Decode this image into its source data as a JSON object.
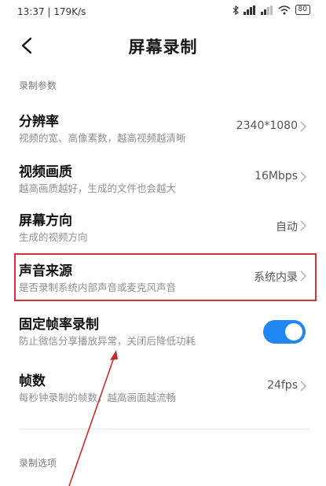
{
  "status_bar": {
    "time_speed": "13:37 | 179K/s",
    "battery": "80"
  },
  "header": {
    "title": "屏幕录制"
  },
  "sections": {
    "recording_params": "录制参数",
    "recording_options": "录制选项"
  },
  "settings": [
    {
      "title": "分辨率",
      "desc": "视频的宽、高像素数，越高视频越清晰",
      "value": "2340*1080"
    },
    {
      "title": "视频画质",
      "desc": "越高画质越好，生成的文件也会越大",
      "value": "16Mbps"
    },
    {
      "title": "屏幕方向",
      "desc": "生成的视频方向",
      "value": "自动"
    },
    {
      "title": "声音来源",
      "desc": "是否录制系统内部声音或麦克风声音",
      "value": "系统内录"
    },
    {
      "title": "固定帧率录制",
      "desc": "防止微信分享播放异常，关闭后降低功耗",
      "toggle_on": true
    },
    {
      "title": "帧数",
      "desc": "每秒钟录制的帧数，越高画面越流畅",
      "value": "24fps"
    }
  ],
  "colors": {
    "accent": "#1f86f2",
    "annotation": "#d3323a"
  }
}
